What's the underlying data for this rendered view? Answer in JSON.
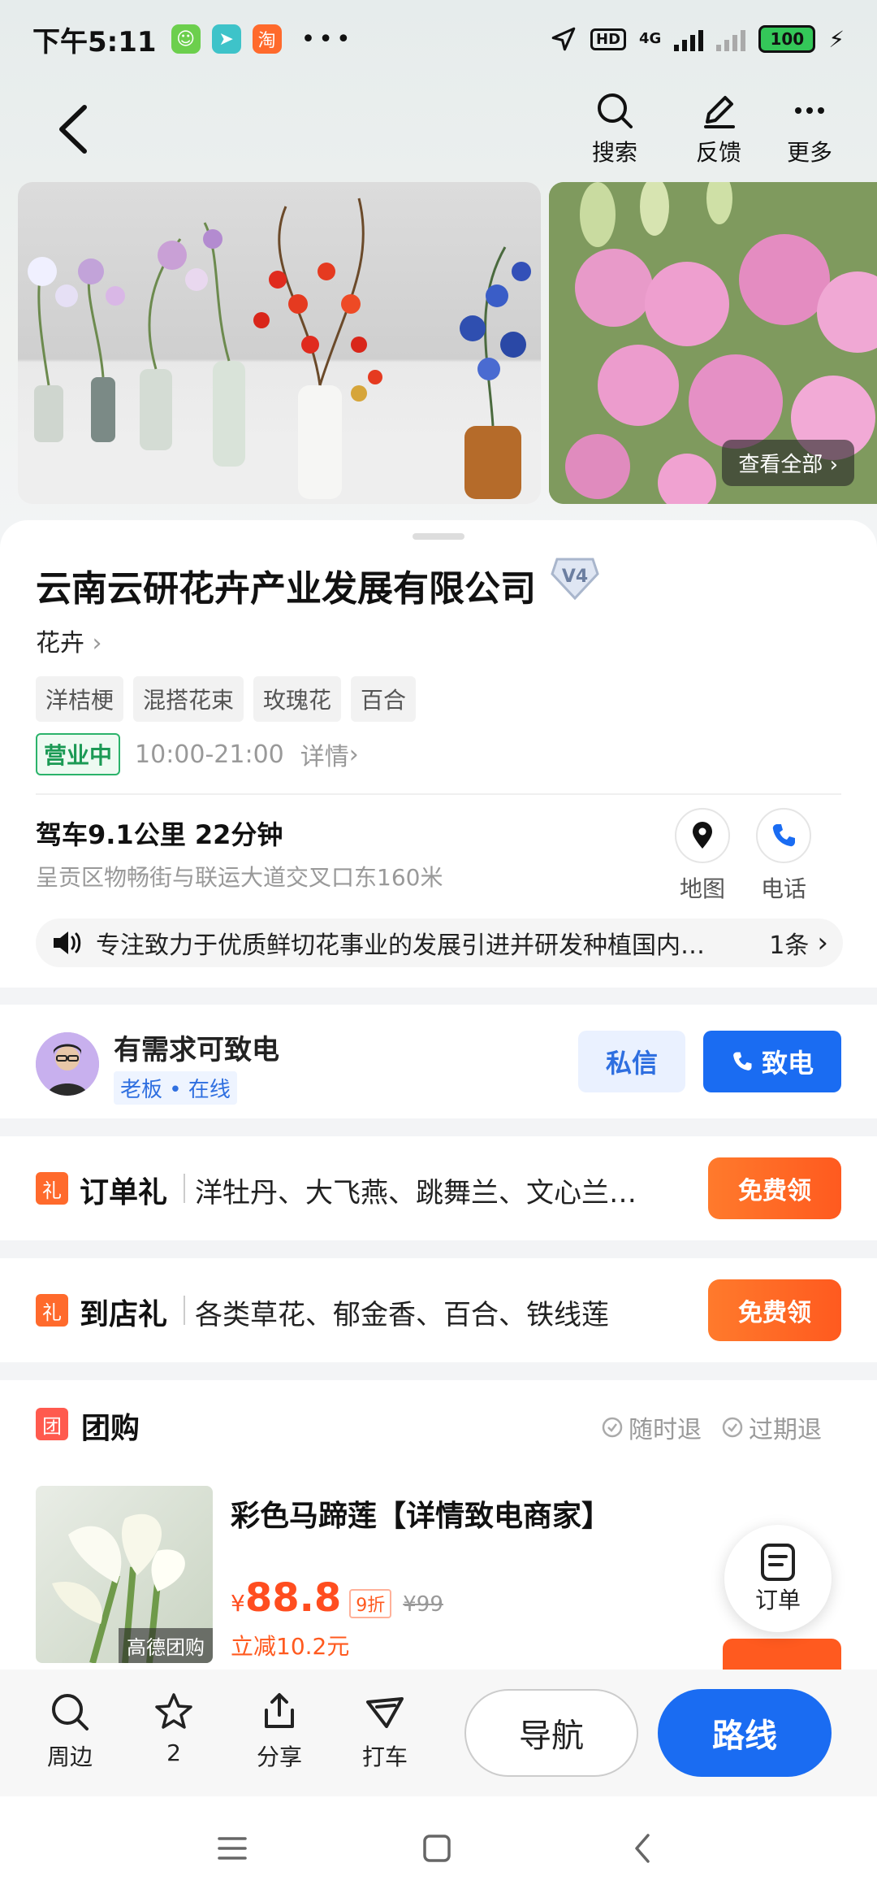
{
  "status_bar": {
    "time": "下午5:11",
    "network": "4G",
    "battery": "100"
  },
  "header": {
    "actions": [
      {
        "label": "搜索",
        "icon": "search-icon"
      },
      {
        "label": "反馈",
        "icon": "edit-icon"
      },
      {
        "label": "更多",
        "icon": "more-icon"
      }
    ]
  },
  "gallery": {
    "view_all": "查看全部"
  },
  "place": {
    "name": "云南云研花卉产业发展有限公司",
    "level_badge": "V4",
    "category": "花卉",
    "tags": [
      "洋桔梗",
      "混搭花束",
      "玫瑰花",
      "百合"
    ],
    "open_status": "营业中",
    "hours": "10:00-21:00",
    "details_link": "详情",
    "drive_info": "驾车9.1公里 22分钟",
    "address": "呈贡区物畅街与联运大道交叉口东160米",
    "map_label": "地图",
    "phone_label": "电话",
    "notice": "专注致力于优质鲜切花事业的发展引进并研发种植国内…",
    "notice_count": "1条"
  },
  "contact": {
    "title": "有需求可致电",
    "badge": "老板 • 在线",
    "message_label": "私信",
    "call_label": "致电"
  },
  "gifts": [
    {
      "icon_text": "礼",
      "name": "订单礼",
      "desc": "洋牡丹、大飞燕、跳舞兰、文心兰…",
      "button": "免费领"
    },
    {
      "icon_text": "礼",
      "name": "到店礼",
      "desc": "各类草花、郁金香、百合、铁线莲",
      "button": "免费领"
    }
  ],
  "group_buy": {
    "icon_text": "团",
    "title": "团购",
    "policies": [
      "随时退",
      "过期退"
    ],
    "deal": {
      "title": "彩色马蹄莲【详情致电商家】",
      "image_label": "高德团购",
      "currency": "¥",
      "price": "88.8",
      "discount": "9折",
      "original_price": "¥99",
      "savings": "立减10.2元"
    }
  },
  "order_fab": {
    "label": "订单"
  },
  "bottom_bar": {
    "items": [
      {
        "label": "周边",
        "icon": "search-icon"
      },
      {
        "label": "2",
        "icon": "star-icon"
      },
      {
        "label": "分享",
        "icon": "share-icon"
      },
      {
        "label": "打车",
        "icon": "taxi-icon"
      }
    ],
    "navigate_label": "导航",
    "route_label": "路线"
  },
  "colors": {
    "accent_blue": "#1a6cf2",
    "accent_orange": "#ff5a1f",
    "open_green": "#1c9a55"
  }
}
